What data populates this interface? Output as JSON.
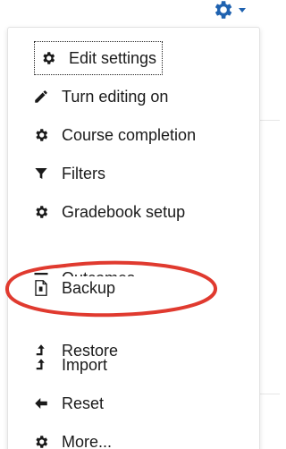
{
  "menu": {
    "trigger": {
      "icon": "gear-icon",
      "caret": "caret-down-icon"
    },
    "items": [
      {
        "label": "Edit settings",
        "icon": "gear-icon"
      },
      {
        "label": "Turn editing on",
        "icon": "pencil-icon"
      },
      {
        "label": "Course completion",
        "icon": "gear-icon"
      },
      {
        "label": "Filters",
        "icon": "filter-icon"
      },
      {
        "label": "Gradebook setup",
        "icon": "gear-icon"
      },
      {
        "label": "Outcomes",
        "icon": "list-icon"
      },
      {
        "label": "Backup",
        "icon": "file-icon"
      },
      {
        "label": "Restore",
        "icon": "upload-icon"
      },
      {
        "label": "Import",
        "icon": "upload-icon"
      },
      {
        "label": "Reset",
        "icon": "arrow-left-icon"
      },
      {
        "label": "More...",
        "icon": "gear-icon"
      }
    ]
  },
  "colors": {
    "icon": "#1a1a1a",
    "trigger_icon": "#1f62b0",
    "annotation": "#e03a2f"
  }
}
